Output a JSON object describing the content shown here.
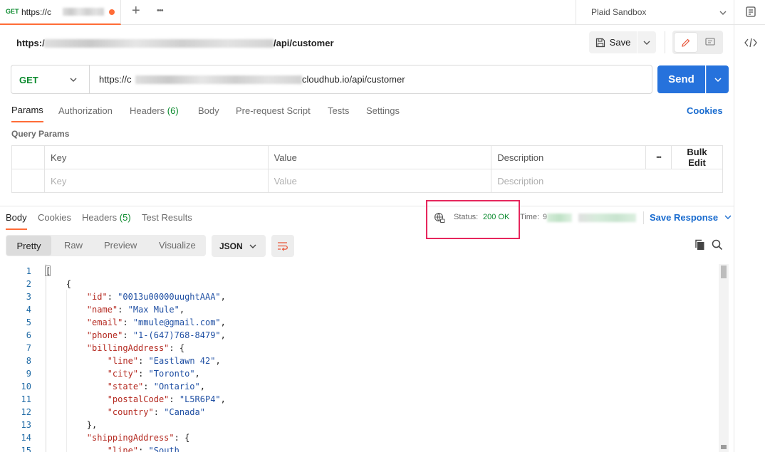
{
  "tab": {
    "method": "GET",
    "title": "https://c",
    "new_tab": "+",
    "more": "•••"
  },
  "environment": {
    "name": "Plaid Sandbox"
  },
  "request": {
    "name_prefix": "https:/",
    "name_suffix": "/api/customer",
    "save_label": "Save",
    "method": "GET",
    "url_prefix": "https://c",
    "url_suffix": "cloudhub.io/api/customer",
    "send_label": "Send"
  },
  "request_tabs": [
    {
      "label": "Params"
    },
    {
      "label": "Authorization"
    },
    {
      "label": "Headers",
      "count": "(6)"
    },
    {
      "label": "Body"
    },
    {
      "label": "Pre-request Script"
    },
    {
      "label": "Tests"
    },
    {
      "label": "Settings"
    }
  ],
  "cookies_link": "Cookies",
  "query_params": {
    "title": "Query Params",
    "headers": {
      "key": "Key",
      "value": "Value",
      "description": "Description",
      "more": "•••",
      "bulk_edit": "Bulk Edit"
    },
    "placeholders": {
      "key": "Key",
      "value": "Value",
      "description": "Description"
    }
  },
  "response_tabs": [
    {
      "label": "Body"
    },
    {
      "label": "Cookies"
    },
    {
      "label": "Headers",
      "count": "(5)"
    },
    {
      "label": "Test Results"
    }
  ],
  "response_meta": {
    "status_label": "Status:",
    "status_value": "200 OK",
    "time_label": "Time:",
    "time_value": "9",
    "save_response": "Save Response"
  },
  "view_modes": [
    "Pretty",
    "Raw",
    "Preview",
    "Visualize"
  ],
  "format": "JSON",
  "code": {
    "line_numbers": [
      "1",
      "2",
      "3",
      "4",
      "5",
      "6",
      "7",
      "8",
      "9",
      "10",
      "11",
      "12",
      "13",
      "14",
      "15"
    ],
    "lines": [
      [
        {
          "t": "[",
          "c": "p"
        }
      ],
      [
        {
          "t": "    {",
          "c": "p"
        }
      ],
      [
        {
          "t": "        ",
          "c": "p"
        },
        {
          "t": "\"id\"",
          "c": "k"
        },
        {
          "t": ": ",
          "c": "p"
        },
        {
          "t": "\"0013u00000uughtAAA\"",
          "c": "s"
        },
        {
          "t": ",",
          "c": "p"
        }
      ],
      [
        {
          "t": "        ",
          "c": "p"
        },
        {
          "t": "\"name\"",
          "c": "k"
        },
        {
          "t": ": ",
          "c": "p"
        },
        {
          "t": "\"Max Mule\"",
          "c": "s"
        },
        {
          "t": ",",
          "c": "p"
        }
      ],
      [
        {
          "t": "        ",
          "c": "p"
        },
        {
          "t": "\"email\"",
          "c": "k"
        },
        {
          "t": ": ",
          "c": "p"
        },
        {
          "t": "\"mmule@gmail.com\"",
          "c": "s"
        },
        {
          "t": ",",
          "c": "p"
        }
      ],
      [
        {
          "t": "        ",
          "c": "p"
        },
        {
          "t": "\"phone\"",
          "c": "k"
        },
        {
          "t": ": ",
          "c": "p"
        },
        {
          "t": "\"1-(647)768-8479\"",
          "c": "s"
        },
        {
          "t": ",",
          "c": "p"
        }
      ],
      [
        {
          "t": "        ",
          "c": "p"
        },
        {
          "t": "\"billingAddress\"",
          "c": "k"
        },
        {
          "t": ": {",
          "c": "p"
        }
      ],
      [
        {
          "t": "            ",
          "c": "p"
        },
        {
          "t": "\"line\"",
          "c": "k"
        },
        {
          "t": ": ",
          "c": "p"
        },
        {
          "t": "\"Eastlawn 42\"",
          "c": "s"
        },
        {
          "t": ",",
          "c": "p"
        }
      ],
      [
        {
          "t": "            ",
          "c": "p"
        },
        {
          "t": "\"city\"",
          "c": "k"
        },
        {
          "t": ": ",
          "c": "p"
        },
        {
          "t": "\"Toronto\"",
          "c": "s"
        },
        {
          "t": ",",
          "c": "p"
        }
      ],
      [
        {
          "t": "            ",
          "c": "p"
        },
        {
          "t": "\"state\"",
          "c": "k"
        },
        {
          "t": ": ",
          "c": "p"
        },
        {
          "t": "\"Ontario\"",
          "c": "s"
        },
        {
          "t": ",",
          "c": "p"
        }
      ],
      [
        {
          "t": "            ",
          "c": "p"
        },
        {
          "t": "\"postalCode\"",
          "c": "k"
        },
        {
          "t": ": ",
          "c": "p"
        },
        {
          "t": "\"L5R6P4\"",
          "c": "s"
        },
        {
          "t": ",",
          "c": "p"
        }
      ],
      [
        {
          "t": "            ",
          "c": "p"
        },
        {
          "t": "\"country\"",
          "c": "k"
        },
        {
          "t": ": ",
          "c": "p"
        },
        {
          "t": "\"Canada\"",
          "c": "s"
        }
      ],
      [
        {
          "t": "        },",
          "c": "p"
        }
      ],
      [
        {
          "t": "        ",
          "c": "p"
        },
        {
          "t": "\"shippingAddress\"",
          "c": "k"
        },
        {
          "t": ": {",
          "c": "p"
        }
      ],
      [
        {
          "t": "            ",
          "c": "p"
        },
        {
          "t": "\"line\"",
          "c": "k"
        },
        {
          "t": ": ",
          "c": "p"
        },
        {
          "t": "\"South",
          "c": "s"
        }
      ]
    ]
  },
  "colors": {
    "accent": "#ff6c37",
    "send": "#2672dc",
    "link": "#1a6ccf",
    "status_ok": "#0a8a2d",
    "highlight_box": "#e6275d"
  }
}
